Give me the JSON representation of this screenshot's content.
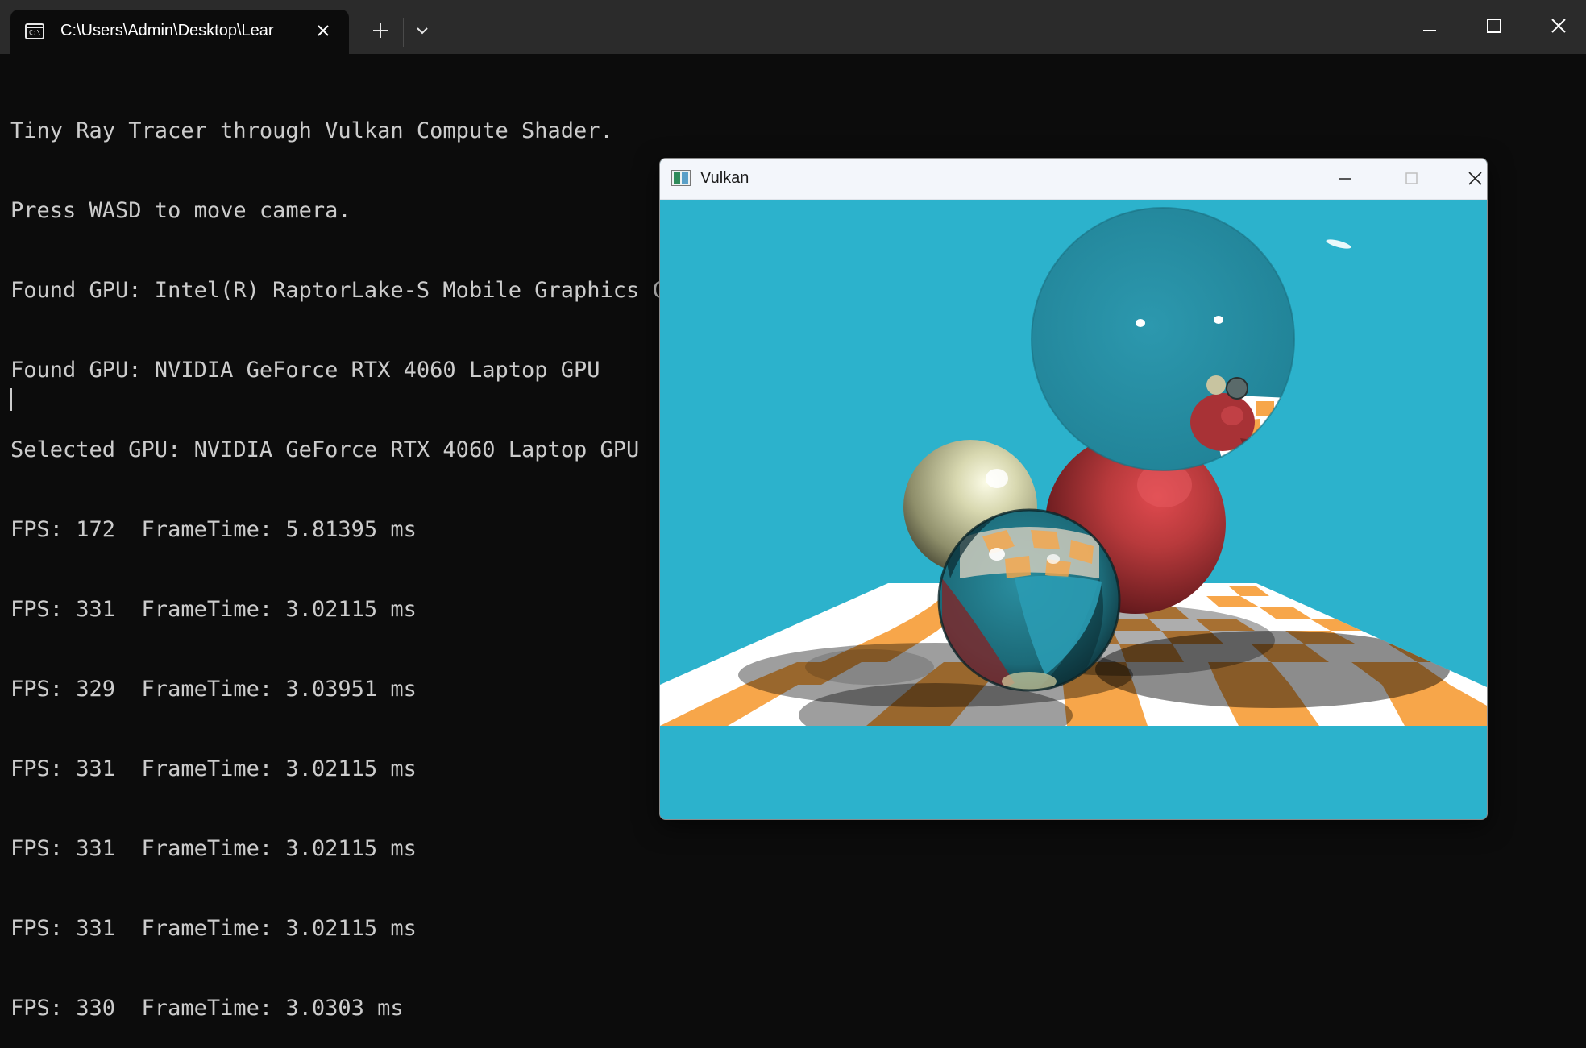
{
  "terminal": {
    "tab_title": "C:\\Users\\Admin\\Desktop\\Lear",
    "tab_icon": "command-prompt-icon",
    "tab_icon_text": "C:\\",
    "new_tab_icon": "plus-icon",
    "dropdown_icon": "chevron-down-icon",
    "window_controls": [
      "minimize-icon",
      "maximize-icon",
      "close-icon"
    ],
    "lines": [
      "Tiny Ray Tracer through Vulkan Compute Shader.",
      "Press WASD to move camera.",
      "Found GPU: Intel(R) RaptorLake-S Mobile Graphics Controller",
      "Found GPU: NVIDIA GeForce RTX 4060 Laptop GPU",
      "Selected GPU: NVIDIA GeForce RTX 4060 Laptop GPU",
      "FPS: 172  FrameTime: 5.81395 ms",
      "FPS: 331  FrameTime: 3.02115 ms",
      "FPS: 329  FrameTime: 3.03951 ms",
      "FPS: 331  FrameTime: 3.02115 ms",
      "FPS: 331  FrameTime: 3.02115 ms",
      "FPS: 331  FrameTime: 3.02115 ms",
      "FPS: 330  FrameTime: 3.0303 ms"
    ]
  },
  "vulkan_window": {
    "title": "Vulkan",
    "app_icon": "vulkan-app-icon",
    "window_controls": [
      "minimize-icon",
      "maximize-icon",
      "close-icon"
    ],
    "scene": {
      "background_color": "#2cb2cc",
      "floor_colors": [
        "#ffffff",
        "#f7a64a"
      ],
      "objects": [
        "ivory-sphere",
        "glass-sphere",
        "red-sphere",
        "mirror-sphere",
        "checkerboard-floor"
      ]
    }
  },
  "colors": {
    "terminal_bg": "#0c0c0c",
    "terminal_text": "#cccccc",
    "titlebar_bg": "#2b2b2b",
    "sky": "#2cb2cc",
    "orange": "#f7a64a"
  }
}
